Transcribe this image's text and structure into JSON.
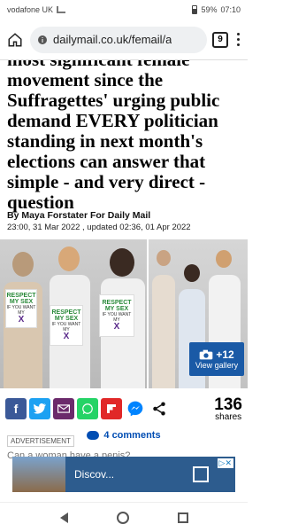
{
  "status": {
    "carrier": "vodafone UK",
    "battery": "59%",
    "time": "07:10"
  },
  "browser": {
    "url": "dailymail.co.uk/femail/a",
    "tab_count": "9"
  },
  "article": {
    "headline": "most significant female movement since the Suffragettes' urging public demand EVERY politician standing in next month's elections can answer that simple - and very direct - question",
    "byline": "By Maya Forstater For Daily Mail",
    "dateline": "23:00, 31 Mar 2022 , updated 02:36, 01 Apr 2022"
  },
  "photo": {
    "sign_line1": "RESPECT MY SEX",
    "sign_line2": "IF YOU WANT MY",
    "sign_mark": "X",
    "gallery_count": "+12",
    "gallery_label": "View gallery"
  },
  "share": {
    "count": "136",
    "label": "shares",
    "icons": [
      "facebook-icon",
      "twitter-icon",
      "email-icon",
      "whatsapp-icon",
      "flipboard-icon",
      "messenger-icon",
      "share-icon"
    ],
    "colors": {
      "facebook": "#3b5998",
      "twitter": "#1da1f2",
      "email": "#6b2a6b",
      "whatsapp": "#25d366",
      "flipboard": "#e12828",
      "messenger": "#0084ff"
    }
  },
  "comments": {
    "label": "4 comments"
  },
  "ad": {
    "label": "ADVERTISEMENT",
    "next_title": "Can a woman have a penis?",
    "banner_text": "Discov..."
  }
}
